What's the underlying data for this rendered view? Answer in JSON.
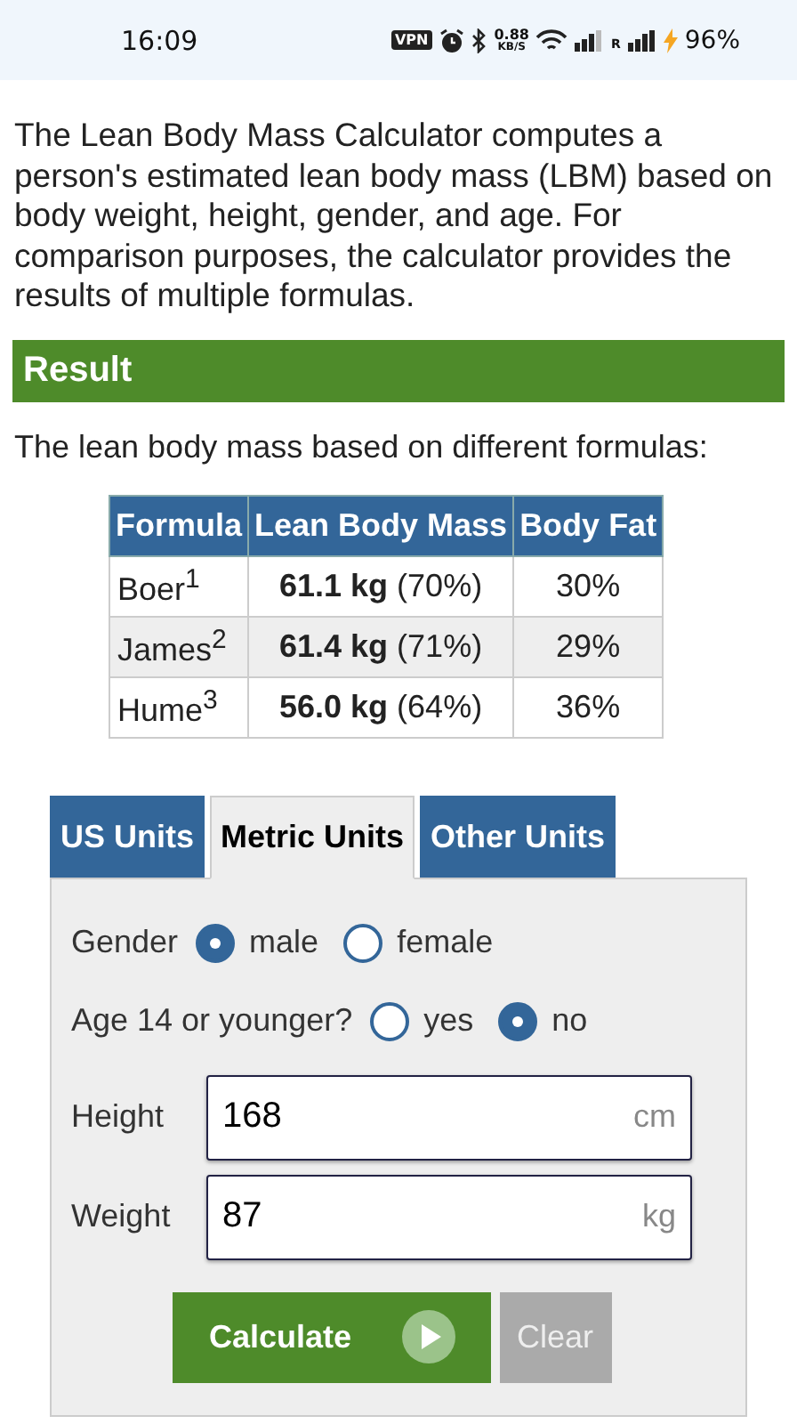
{
  "status_bar": {
    "time": "16:09",
    "vpn": "VPN",
    "speed": "0.88",
    "speed_unit": "KB/S",
    "roaming": "R",
    "battery": "96%"
  },
  "intro": "The Lean Body Mass Calculator computes a person's estimated lean body mass (LBM) based on body weight, height, gender, and age. For comparison purposes, the calculator provides the results of multiple formulas.",
  "result": {
    "title": "Result",
    "caption": "The lean body mass based on different formulas:",
    "table": {
      "columns": [
        "Formula",
        "Lean Body Mass",
        "Body Fat"
      ],
      "rows": [
        [
          "Boer$^{1}$",
          "**61.1 kg** (70%)",
          "30%"
        ],
        [
          "James$^{2}$",
          "**61.4 kg** (71%)",
          "29%"
        ],
        [
          "Hume$^{3}$",
          "**56.0 kg** (64%)",
          "36%"
        ]
      ]
    }
  },
  "tabs": [
    {
      "label": "US Units",
      "selected": false
    },
    {
      "label": "Metric Units",
      "selected": true
    },
    {
      "label": "Other Units",
      "selected": false
    }
  ],
  "radio_groups": [
    {
      "label": "Gender",
      "options": [
        {
          "label": "male",
          "selected": true
        },
        {
          "label": "female",
          "selected": false
        }
      ]
    },
    {
      "label": "Age 14 or younger?",
      "options": [
        {
          "label": "yes",
          "selected": false
        },
        {
          "label": "no",
          "selected": true
        }
      ]
    }
  ],
  "fields": [
    {
      "label": "Height",
      "value": "168",
      "unit": "cm"
    },
    {
      "label": "Weight",
      "value": "87",
      "unit": "kg"
    }
  ],
  "buttons": [
    {
      "label": "Calculate",
      "kind": "primary"
    },
    {
      "label": "Clear",
      "kind": "secondary"
    }
  ]
}
